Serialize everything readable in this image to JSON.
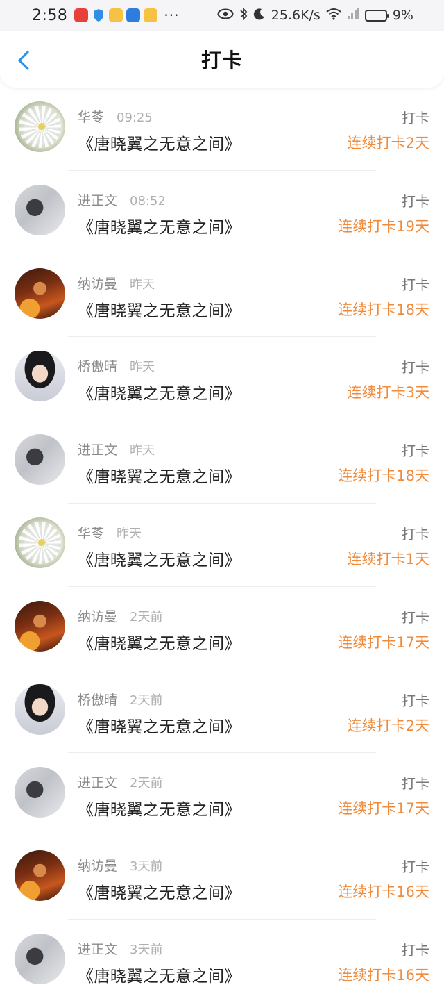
{
  "status_bar": {
    "time": "2:58",
    "dots": "···",
    "network_speed": "25.6K/s",
    "battery": "9%"
  },
  "nav": {
    "title": "打卡"
  },
  "entries": [
    {
      "name": "华苓",
      "time": "09:25",
      "book": "《唐晓翼之无意之间》",
      "action": "打卡",
      "streak": "连续打卡2天",
      "avatar": "daisy"
    },
    {
      "name": "进正文",
      "time": "08:52",
      "book": "《唐晓翼之无意之间》",
      "action": "打卡",
      "streak": "连续打卡19天",
      "avatar": "girl-white"
    },
    {
      "name": "纳访曼",
      "time": "昨天",
      "book": "《唐晓翼之无意之间》",
      "action": "打卡",
      "streak": "连续打卡18天",
      "avatar": "warrior"
    },
    {
      "name": "桥傲晴",
      "time": "昨天",
      "book": "《唐晓翼之无意之间》",
      "action": "打卡",
      "streak": "连续打卡3天",
      "avatar": "girl-dark"
    },
    {
      "name": "进正文",
      "time": "昨天",
      "book": "《唐晓翼之无意之间》",
      "action": "打卡",
      "streak": "连续打卡18天",
      "avatar": "girl-white"
    },
    {
      "name": "华苓",
      "time": "昨天",
      "book": "《唐晓翼之无意之间》",
      "action": "打卡",
      "streak": "连续打卡1天",
      "avatar": "daisy"
    },
    {
      "name": "纳访曼",
      "time": "2天前",
      "book": "《唐晓翼之无意之间》",
      "action": "打卡",
      "streak": "连续打卡17天",
      "avatar": "warrior"
    },
    {
      "name": "桥傲晴",
      "time": "2天前",
      "book": "《唐晓翼之无意之间》",
      "action": "打卡",
      "streak": "连续打卡2天",
      "avatar": "girl-dark"
    },
    {
      "name": "进正文",
      "time": "2天前",
      "book": "《唐晓翼之无意之间》",
      "action": "打卡",
      "streak": "连续打卡17天",
      "avatar": "girl-white"
    },
    {
      "name": "纳访曼",
      "time": "3天前",
      "book": "《唐晓翼之无意之间》",
      "action": "打卡",
      "streak": "连续打卡16天",
      "avatar": "warrior"
    },
    {
      "name": "进正文",
      "time": "3天前",
      "book": "《唐晓翼之无意之间》",
      "action": "打卡",
      "streak": "连续打卡16天",
      "avatar": "girl-white"
    }
  ],
  "colors": {
    "accent_back": "#2f8ee6",
    "streak": "#f08b3c"
  }
}
